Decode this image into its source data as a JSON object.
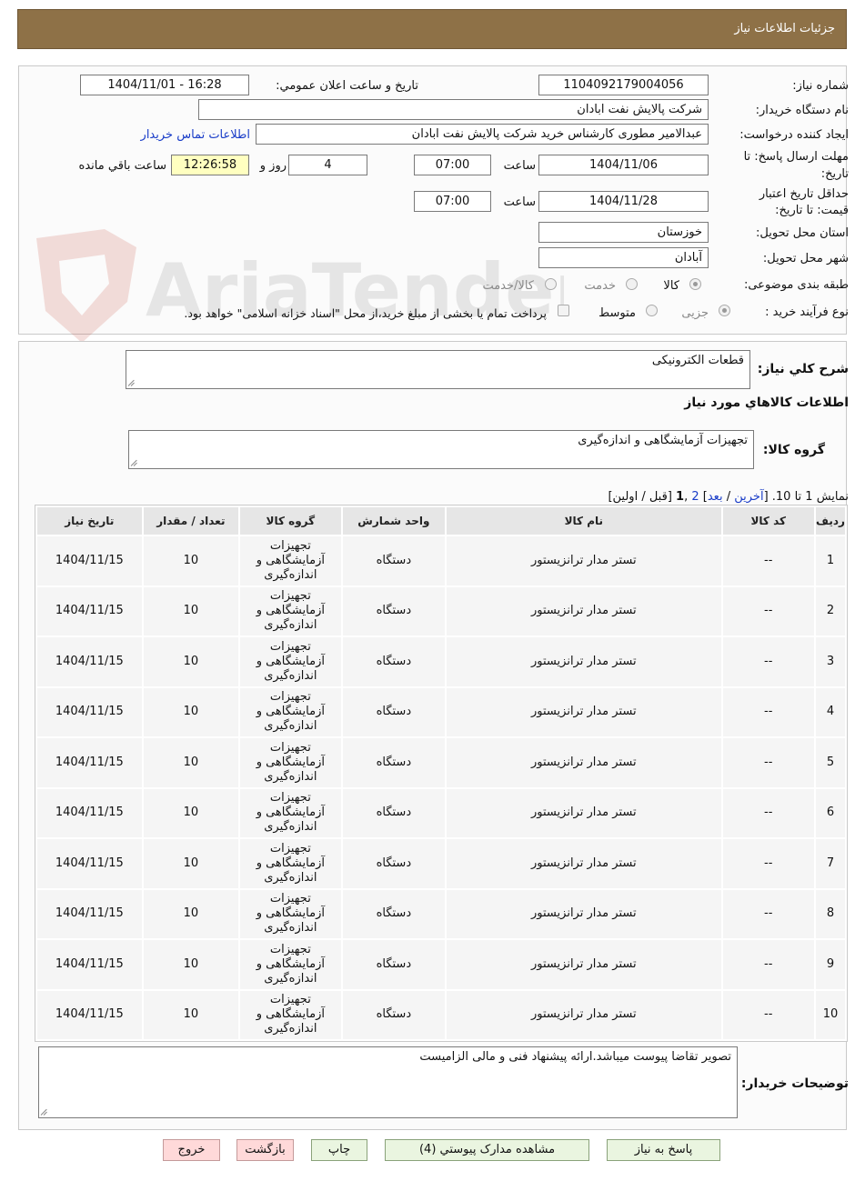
{
  "header": {
    "title": "جزئیات اطلاعات نیاز"
  },
  "watermark": {
    "text": "AriaTender.neT"
  },
  "info": {
    "need_number_label": "شماره نیاز:",
    "need_number": "1104092179004056",
    "announce_label": "تاریخ و ساعت اعلان عمومي:",
    "announce_value": "1404/11/01 - 16:28",
    "buyer_label": "نام دستگاه خریدار:",
    "buyer_value": "شرکت پالایش نفت ابادان",
    "creator_label": "ایجاد کننده درخواست:",
    "creator_value": "عبدالامیر مطوری کارشناس خرید  شرکت پالایش نفت ابادان",
    "contact_link": "اطلاعات تماس خریدار",
    "deadline_label_1": "مهلت ارسال پاسخ: تا",
    "deadline_label_2": "تاریخ:",
    "deadline_date": "1404/11/06",
    "time_label": "ساعت",
    "deadline_time": "07:00",
    "days_value": "4",
    "days_label": "روز و",
    "remaining_time": "12:26:58",
    "remaining_label": "ساعت باقي مانده",
    "validity_label_1": "حداقل تاریخ اعتبار",
    "validity_label_2": "قیمت: تا تاریخ:",
    "validity_date": "1404/11/28",
    "validity_time": "07:00",
    "province_label": "استان محل تحویل:",
    "province_value": "خوزستان",
    "city_label": "شهر محل تحویل:",
    "city_value": "آبادان",
    "category_label": "طبقه بندی موضوعی:",
    "category_options": [
      "کالا",
      "خدمت",
      "کالا/خدمت"
    ],
    "process_label": "نوع فرآیند خرید :",
    "process_options": [
      "جزیی",
      "متوسط"
    ],
    "payment_note": "پرداخت تمام یا بخشی از مبلغ خرید،از محل \"اسناد خزانه اسلامی\" خواهد بود."
  },
  "summary": {
    "desc_label": "شرح کلي نیاز:",
    "desc_value": "قطعات الکترونیکی",
    "goods_info_title": "اطلاعات کالاهاي مورد نیاز",
    "group_label": "گروه کالا:",
    "group_value": "تجهیزات آزمایشگاهی و اندازه‌گیری"
  },
  "pagination": {
    "prefix": "نمایش 1 تا 10. [",
    "last": "آخرین",
    "sep1": " / ",
    "next": "بعد",
    "mid": "] ",
    "page2": "2",
    "comma": " ,",
    "page1": "1",
    "suffix": " [قبل / اولین]"
  },
  "table": {
    "headers": [
      "ردیف",
      "کد کالا",
      "نام کالا",
      "واحد شمارش",
      "گروه کالا",
      "تعداد / مقدار",
      "تاریخ نیاز"
    ],
    "rows": [
      [
        "1",
        "--",
        "تستر مدار ترانزیستور",
        "دستگاه",
        "تجهیزات آزمایشگاهی و اندازه‌گیری",
        "10",
        "1404/11/15"
      ],
      [
        "2",
        "--",
        "تستر مدار ترانزیستور",
        "دستگاه",
        "تجهیزات آزمایشگاهی و اندازه‌گیری",
        "10",
        "1404/11/15"
      ],
      [
        "3",
        "--",
        "تستر مدار ترانزیستور",
        "دستگاه",
        "تجهیزات آزمایشگاهی و اندازه‌گیری",
        "10",
        "1404/11/15"
      ],
      [
        "4",
        "--",
        "تستر مدار ترانزیستور",
        "دستگاه",
        "تجهیزات آزمایشگاهی و اندازه‌گیری",
        "10",
        "1404/11/15"
      ],
      [
        "5",
        "--",
        "تستر مدار ترانزیستور",
        "دستگاه",
        "تجهیزات آزمایشگاهی و اندازه‌گیری",
        "10",
        "1404/11/15"
      ],
      [
        "6",
        "--",
        "تستر مدار ترانزیستور",
        "دستگاه",
        "تجهیزات آزمایشگاهی و اندازه‌گیری",
        "10",
        "1404/11/15"
      ],
      [
        "7",
        "--",
        "تستر مدار ترانزیستور",
        "دستگاه",
        "تجهیزات آزمایشگاهی و اندازه‌گیری",
        "10",
        "1404/11/15"
      ],
      [
        "8",
        "--",
        "تستر مدار ترانزیستور",
        "دستگاه",
        "تجهیزات آزمایشگاهی و اندازه‌گیری",
        "10",
        "1404/11/15"
      ],
      [
        "9",
        "--",
        "تستر مدار ترانزیستور",
        "دستگاه",
        "تجهیزات آزمایشگاهی و اندازه‌گیری",
        "10",
        "1404/11/15"
      ],
      [
        "10",
        "--",
        "تستر مدار ترانزیستور",
        "دستگاه",
        "تجهیزات آزمایشگاهی و اندازه‌گیری",
        "10",
        "1404/11/15"
      ]
    ]
  },
  "buyer_notes": {
    "label": "توضیحات خریدار:",
    "value": "تصویر تقاضا پیوست میباشد.ارائه پیشنهاد فنی و مالی الزامیست"
  },
  "buttons": {
    "reply": "پاسخ به نیاز",
    "attachments": "مشاهده مدارک پیوستي (4)",
    "print": "چاپ",
    "back": "بازگشت",
    "exit": "خروج"
  }
}
